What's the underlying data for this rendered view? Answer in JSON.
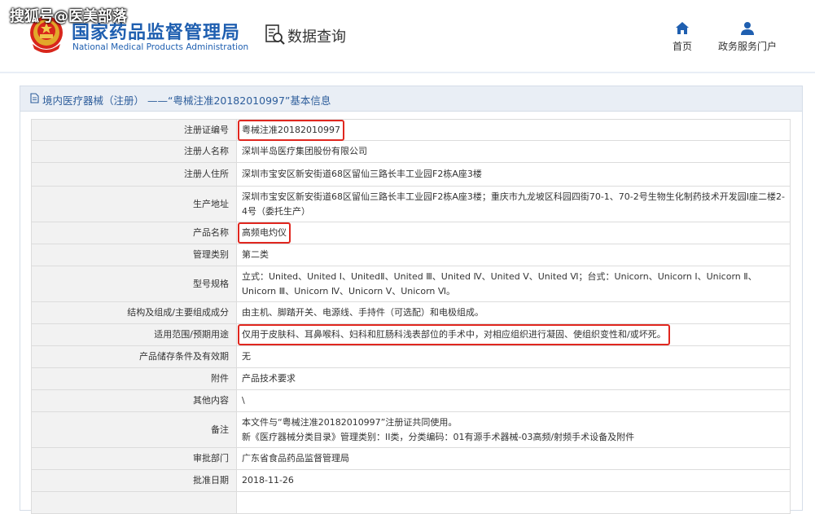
{
  "watermark": "搜狐号@医美部落",
  "header": {
    "logo_cn": "国家药品监督管理局",
    "logo_en": "National Medical Products Administration",
    "section_title": "数据查询",
    "nav": [
      {
        "label": "首页",
        "icon": "home-icon"
      },
      {
        "label": "政务服务门户",
        "icon": "user-icon"
      }
    ]
  },
  "panel": {
    "title": "境内医疗器械（注册） ——“粤械注准20182010997”基本信息"
  },
  "rows": [
    {
      "label": "注册证编号",
      "value": "粤械注准20182010997",
      "highlight": true
    },
    {
      "label": "注册人名称",
      "value": "深圳半岛医疗集团股份有限公司"
    },
    {
      "label": "注册人住所",
      "value": "深圳市宝安区新安街道68区留仙三路长丰工业园F2栋A座3楼"
    },
    {
      "label": "生产地址",
      "value": "深圳市宝安区新安街道68区留仙三路长丰工业园F2栋A座3楼；重庆市九龙坡区科园四街70-1、70-2号生物生化制药技术开发园I座二楼2-4号（委托生产）"
    },
    {
      "label": "产品名称",
      "value": "高频电灼仪",
      "highlight": true
    },
    {
      "label": "管理类别",
      "value": "第二类"
    },
    {
      "label": "型号规格",
      "value": "立式：United、United Ⅰ、UnitedⅡ、United Ⅲ、United Ⅳ、United Ⅴ、United Ⅵ；台式：Unicorn、Unicorn Ⅰ、Unicorn Ⅱ、Unicorn Ⅲ、Unicorn Ⅳ、Unicorn Ⅴ、Unicorn Ⅵ。"
    },
    {
      "label": "结构及组成/主要组成成分",
      "value": "由主机、脚踏开关、电源线、手持件（可选配）和电极组成。"
    },
    {
      "label": "适用范围/预期用途",
      "value": "仅用于皮肤科、耳鼻喉科、妇科和肛肠科浅表部位的手术中，对相应组织进行凝固、使组织变性和/或坏死。",
      "highlight": true
    },
    {
      "label": "产品储存条件及有效期",
      "value": "无"
    },
    {
      "label": "附件",
      "value": "产品技术要求"
    },
    {
      "label": "其他内容",
      "value": "\\"
    },
    {
      "label": "备注",
      "value": "本文件与“粤械注准20182010997”注册证共同使用。",
      "value2": "新《医疗器械分类目录》管理类别：II类，分类编码：01有源手术器械-03高频/射频手术设备及附件"
    },
    {
      "label": "审批部门",
      "value": "广东省食品药品监督管理局"
    },
    {
      "label": "批准日期",
      "value": "2018-11-26"
    },
    {
      "label": "",
      "value": ""
    }
  ]
}
